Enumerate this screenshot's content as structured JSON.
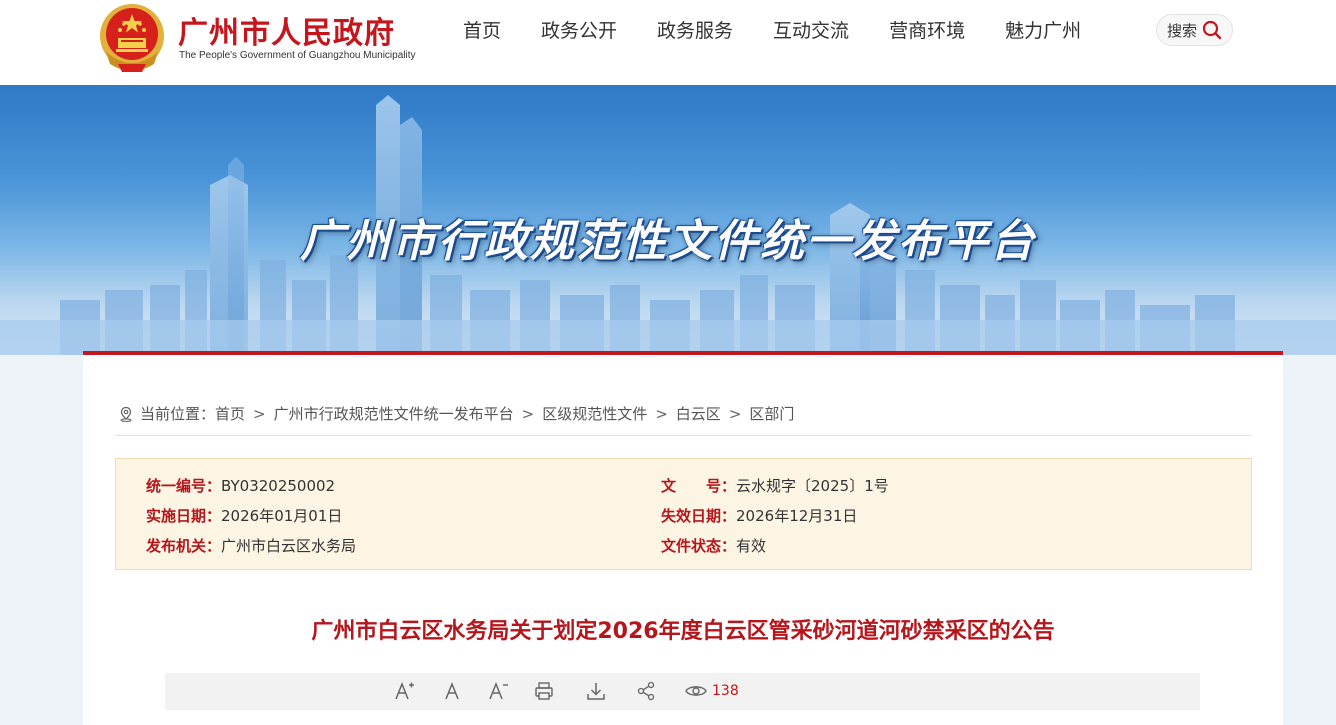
{
  "header": {
    "site_name": "广州市人民政府",
    "site_name_en": "The People's Government of Guangzhou Municipality",
    "nav": [
      "首页",
      "政务公开",
      "政务服务",
      "互动交流",
      "营商环境",
      "魅力广州"
    ],
    "search_label": "搜索"
  },
  "banner": {
    "title": "广州市行政规范性文件统一发布平台"
  },
  "breadcrumb": {
    "prefix": "当前位置：",
    "items": [
      "首页",
      "广州市行政规范性文件统一发布平台",
      "区级规范性文件",
      "白云区",
      "区部门"
    ],
    "separator": ">"
  },
  "meta": {
    "id_label": "统一编号：",
    "id_value": "BY0320250002",
    "doc_no_label": "文　　号：",
    "doc_no_value": "云水规字〔2025〕1号",
    "start_label": "实施日期：",
    "start_value": "2026年01月01日",
    "end_label": "失效日期：",
    "end_value": "2026年12月31日",
    "issuer_label": "发布机关：",
    "issuer_value": "广州市白云区水务局",
    "status_label": "文件状态：",
    "status_value": "有效"
  },
  "document": {
    "title": "广州市白云区水务局关于划定2026年度白云区管采砂河道河砂禁采区的公告"
  },
  "toolbar": {
    "view_count": "138"
  },
  "colors": {
    "brand_red": "#c4161c",
    "meta_bg": "#fcf5e4"
  }
}
